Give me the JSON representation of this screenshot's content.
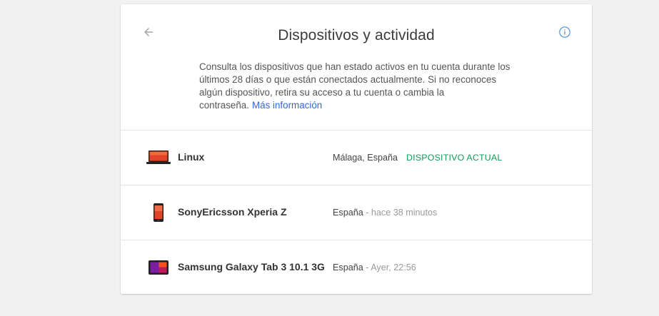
{
  "header": {
    "title": "Dispositivos y actividad",
    "description": "Consulta los dispositivos que han estado activos en tu cuenta durante los últimos 28 días o que están conectados actualmente. Si no reconoces algún dispositivo, retira su acceso a tu cuenta o cambia la contraseña.",
    "more_info_link": "Más información",
    "back_icon": "arrow-back-icon",
    "info_icon": "info-icon"
  },
  "colors": {
    "current_device": "#0f9d58",
    "link": "#3367d6",
    "info_icon": "#4a90d9"
  },
  "devices": [
    {
      "name": "Linux",
      "icon": "laptop-icon",
      "location": "Málaga, España",
      "separator": "",
      "time": "",
      "status": "DISPOSITIVO ACTUAL"
    },
    {
      "name": "SonyEricsson Xperia Z",
      "icon": "phone-icon",
      "location": "España",
      "separator": " - ",
      "time": "hace 38 minutos",
      "status": ""
    },
    {
      "name": "Samsung Galaxy Tab 3 10.1 3G",
      "icon": "tablet-icon",
      "location": "España",
      "separator": " - ",
      "time": "Ayer, 22:56",
      "status": ""
    }
  ]
}
